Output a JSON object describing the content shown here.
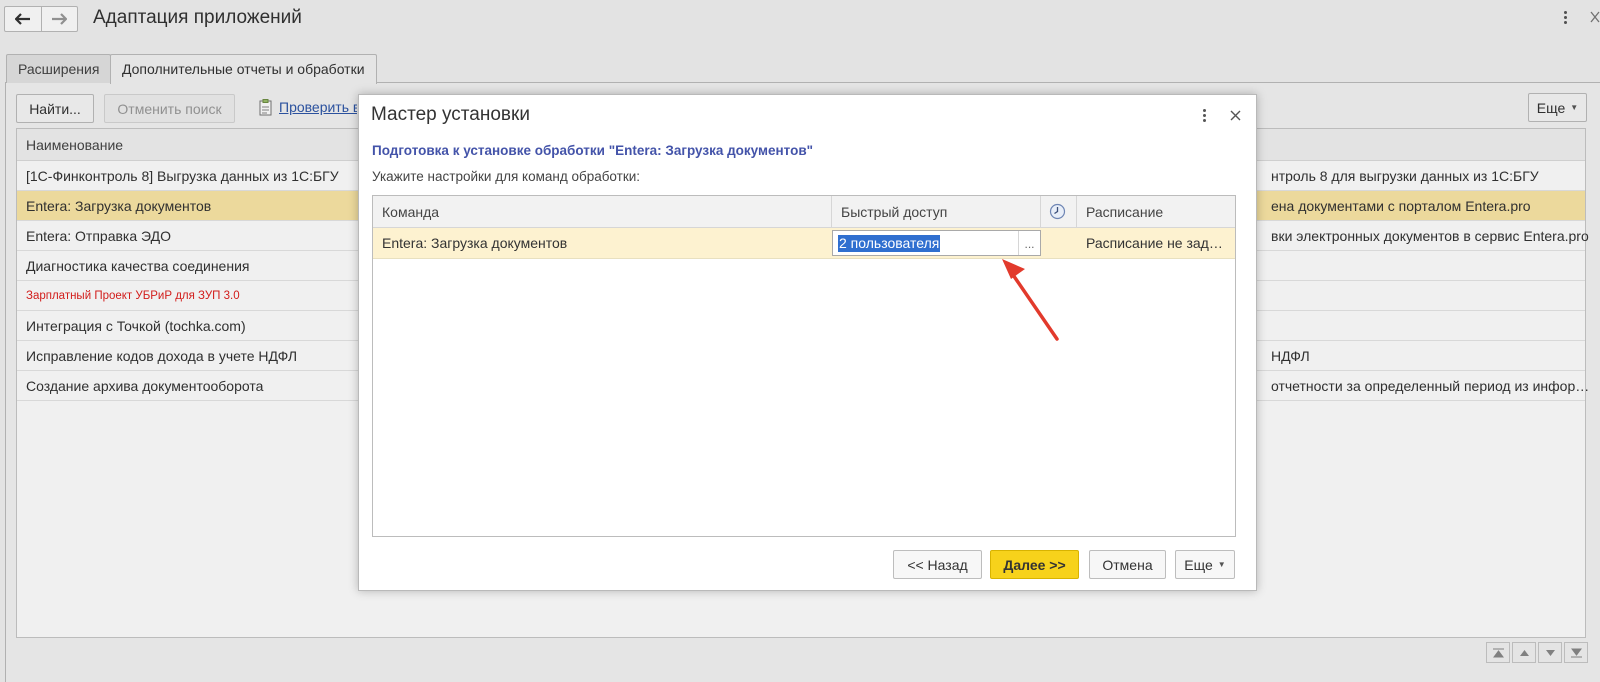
{
  "header": {
    "title": "Адаптация приложений",
    "back_icon": "arrow-left-icon",
    "forward_icon": "arrow-right-icon"
  },
  "tabs": [
    {
      "label": "Расширения",
      "active": false
    },
    {
      "label": "Дополнительные отчеты и обработки",
      "active": true
    }
  ],
  "toolbar": {
    "find_label": "Найти...",
    "cancel_search_label": "Отменить поиск",
    "check_link_label": "Проверить в",
    "more_label": "Еще"
  },
  "bg_table": {
    "header": "Наименование",
    "rows": [
      {
        "name": "[1С-Финконтроль 8] Выгрузка данных из 1С:БГУ",
        "desc": "нтроль 8 для выгрузки данных из 1С:БГУ",
        "selected": false
      },
      {
        "name": "Entera: Загрузка документов",
        "desc": "ена документами с порталом Entera.pro",
        "selected": true
      },
      {
        "name": "Entera: Отправка ЭДО",
        "desc": "вки электронных документов в сервис Entera.pro",
        "selected": false
      },
      {
        "name": "Диагностика качества соединения",
        "desc": "",
        "selected": false
      },
      {
        "name": "Зарплатный Проект УБРиР для ЗУП 3.0",
        "desc": "",
        "selected": false,
        "highlight": "#e0201e"
      },
      {
        "name": "Интеграция с Точкой (tochka.com)",
        "desc": "",
        "selected": false
      },
      {
        "name": "Исправление кодов дохода в учете НДФЛ",
        "desc": "НДФЛ",
        "selected": false
      },
      {
        "name": "Создание архива документооборота",
        "desc": "отчетности за определенный период из инфор…",
        "selected": false
      }
    ]
  },
  "dialog": {
    "title": "Мастер установки",
    "subtitle": "Подготовка к установке обработки \"Entera: Загрузка документов\"",
    "hint": "Укажите настройки для команд обработки:",
    "table": {
      "headers": {
        "command": "Команда",
        "quick_access": "Быстрый доступ",
        "clock_icon": "clock-icon",
        "schedule": "Расписание"
      },
      "rows": [
        {
          "command": "Entera: Загрузка документов",
          "quick_access": "2 пользователя",
          "choose_button": "...",
          "schedule": "Расписание не зад…"
        }
      ]
    },
    "buttons": {
      "back": "<< Назад",
      "next": "Далее >>",
      "cancel": "Отмена",
      "more": "Еще"
    }
  },
  "colors": {
    "accent_yellow": "#f7d21b",
    "selection_row": "#fbe7a6",
    "subtitle_blue": "#4353a9",
    "annotation_arrow": "#e23a2c"
  }
}
